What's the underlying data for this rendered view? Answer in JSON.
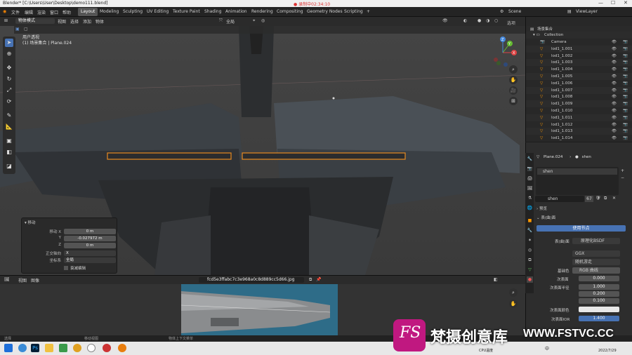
{
  "titlebar": {
    "title": "Blender* [C:\\Users\\User\\Desktop\\demo111.blend]",
    "recording": "● 录制中02:34:10"
  },
  "menu": {
    "items": [
      "文件",
      "编辑",
      "渲染",
      "窗口",
      "帮助"
    ],
    "workspaces": [
      "Layout",
      "Modeling",
      "Sculpting",
      "UV Editing",
      "Texture Paint",
      "Shading",
      "Animation",
      "Rendering",
      "Compositing",
      "Geometry Nodes",
      "Scripting"
    ],
    "scene": "Scene",
    "viewlayer": "ViewLayer"
  },
  "viewport_header": {
    "mode": "物体模式",
    "menus": [
      "视图",
      "选择",
      "添加",
      "物体"
    ],
    "transform": "全局",
    "options": "选项"
  },
  "viewport_info": {
    "line1": "用户透视",
    "line2": "(1) 场景集合 | Plane.024"
  },
  "gizmo": {
    "x": "X",
    "y": "Y",
    "z": "Z"
  },
  "operator": {
    "title": "移动",
    "rows": [
      {
        "label": "移动 X",
        "value": "0 m"
      },
      {
        "label": "Y",
        "value": "-0.027972 m"
      },
      {
        "label": "Z",
        "value": "0 m"
      }
    ],
    "constraint_label": "正交轴向",
    "constraint_value": "X",
    "orient_label": "坐标系",
    "orient_value": "全局",
    "prop_edit": "衰减编辑"
  },
  "outliner": {
    "title": "场景集合",
    "collection": "Collection",
    "items": [
      "Camera",
      "lod1_1.001",
      "lod1_1.002",
      "lod1_1.003",
      "lod1_1.004",
      "lod1_1.005",
      "lod1_1.006",
      "lod1_1.007",
      "lod1_1.008",
      "lod1_1.009",
      "lod1_1.010",
      "lod1_1.011",
      "lod1_1.012",
      "lod1_1.013",
      "lod1_1.014"
    ]
  },
  "properties": {
    "object": "Plane.024",
    "material": "shen",
    "slot": "shen",
    "mat_name": "shen",
    "users": "67",
    "preview": "预览",
    "surface": "表(曲)面",
    "use_nodes": "使用节点",
    "surface_label": "表(曲)面",
    "shader": "原理化BSDF",
    "distribution": "GGX",
    "sss_method": "随机游走",
    "base_color": "基础色",
    "base_color_value": "RGB 曲线",
    "subsurface": "次表面",
    "subsurface_value": "0.000",
    "radius": "次表面半径",
    "radius_values": [
      "1.000",
      "0.200",
      "0.100"
    ],
    "sss_color": "次表面颜色",
    "sss_ior": "次表面IOR",
    "sss_ior_value": "1.400"
  },
  "image_editor": {
    "menus": [
      "视图",
      "图像"
    ],
    "filename": "fcd5e3ffabc7c3e968a0c8d889cc5d66.jpg"
  },
  "status": {
    "left": "选择",
    "mid": "移动视图",
    "right": "物体上下文菜单"
  },
  "taskbar": {
    "cpu": "CPU温度",
    "ime": "中",
    "date": "2022/7/29"
  },
  "watermark": {
    "logo": "FS",
    "cn": "梵摄创意库",
    "url": "WWW.FSTVC.CC"
  }
}
